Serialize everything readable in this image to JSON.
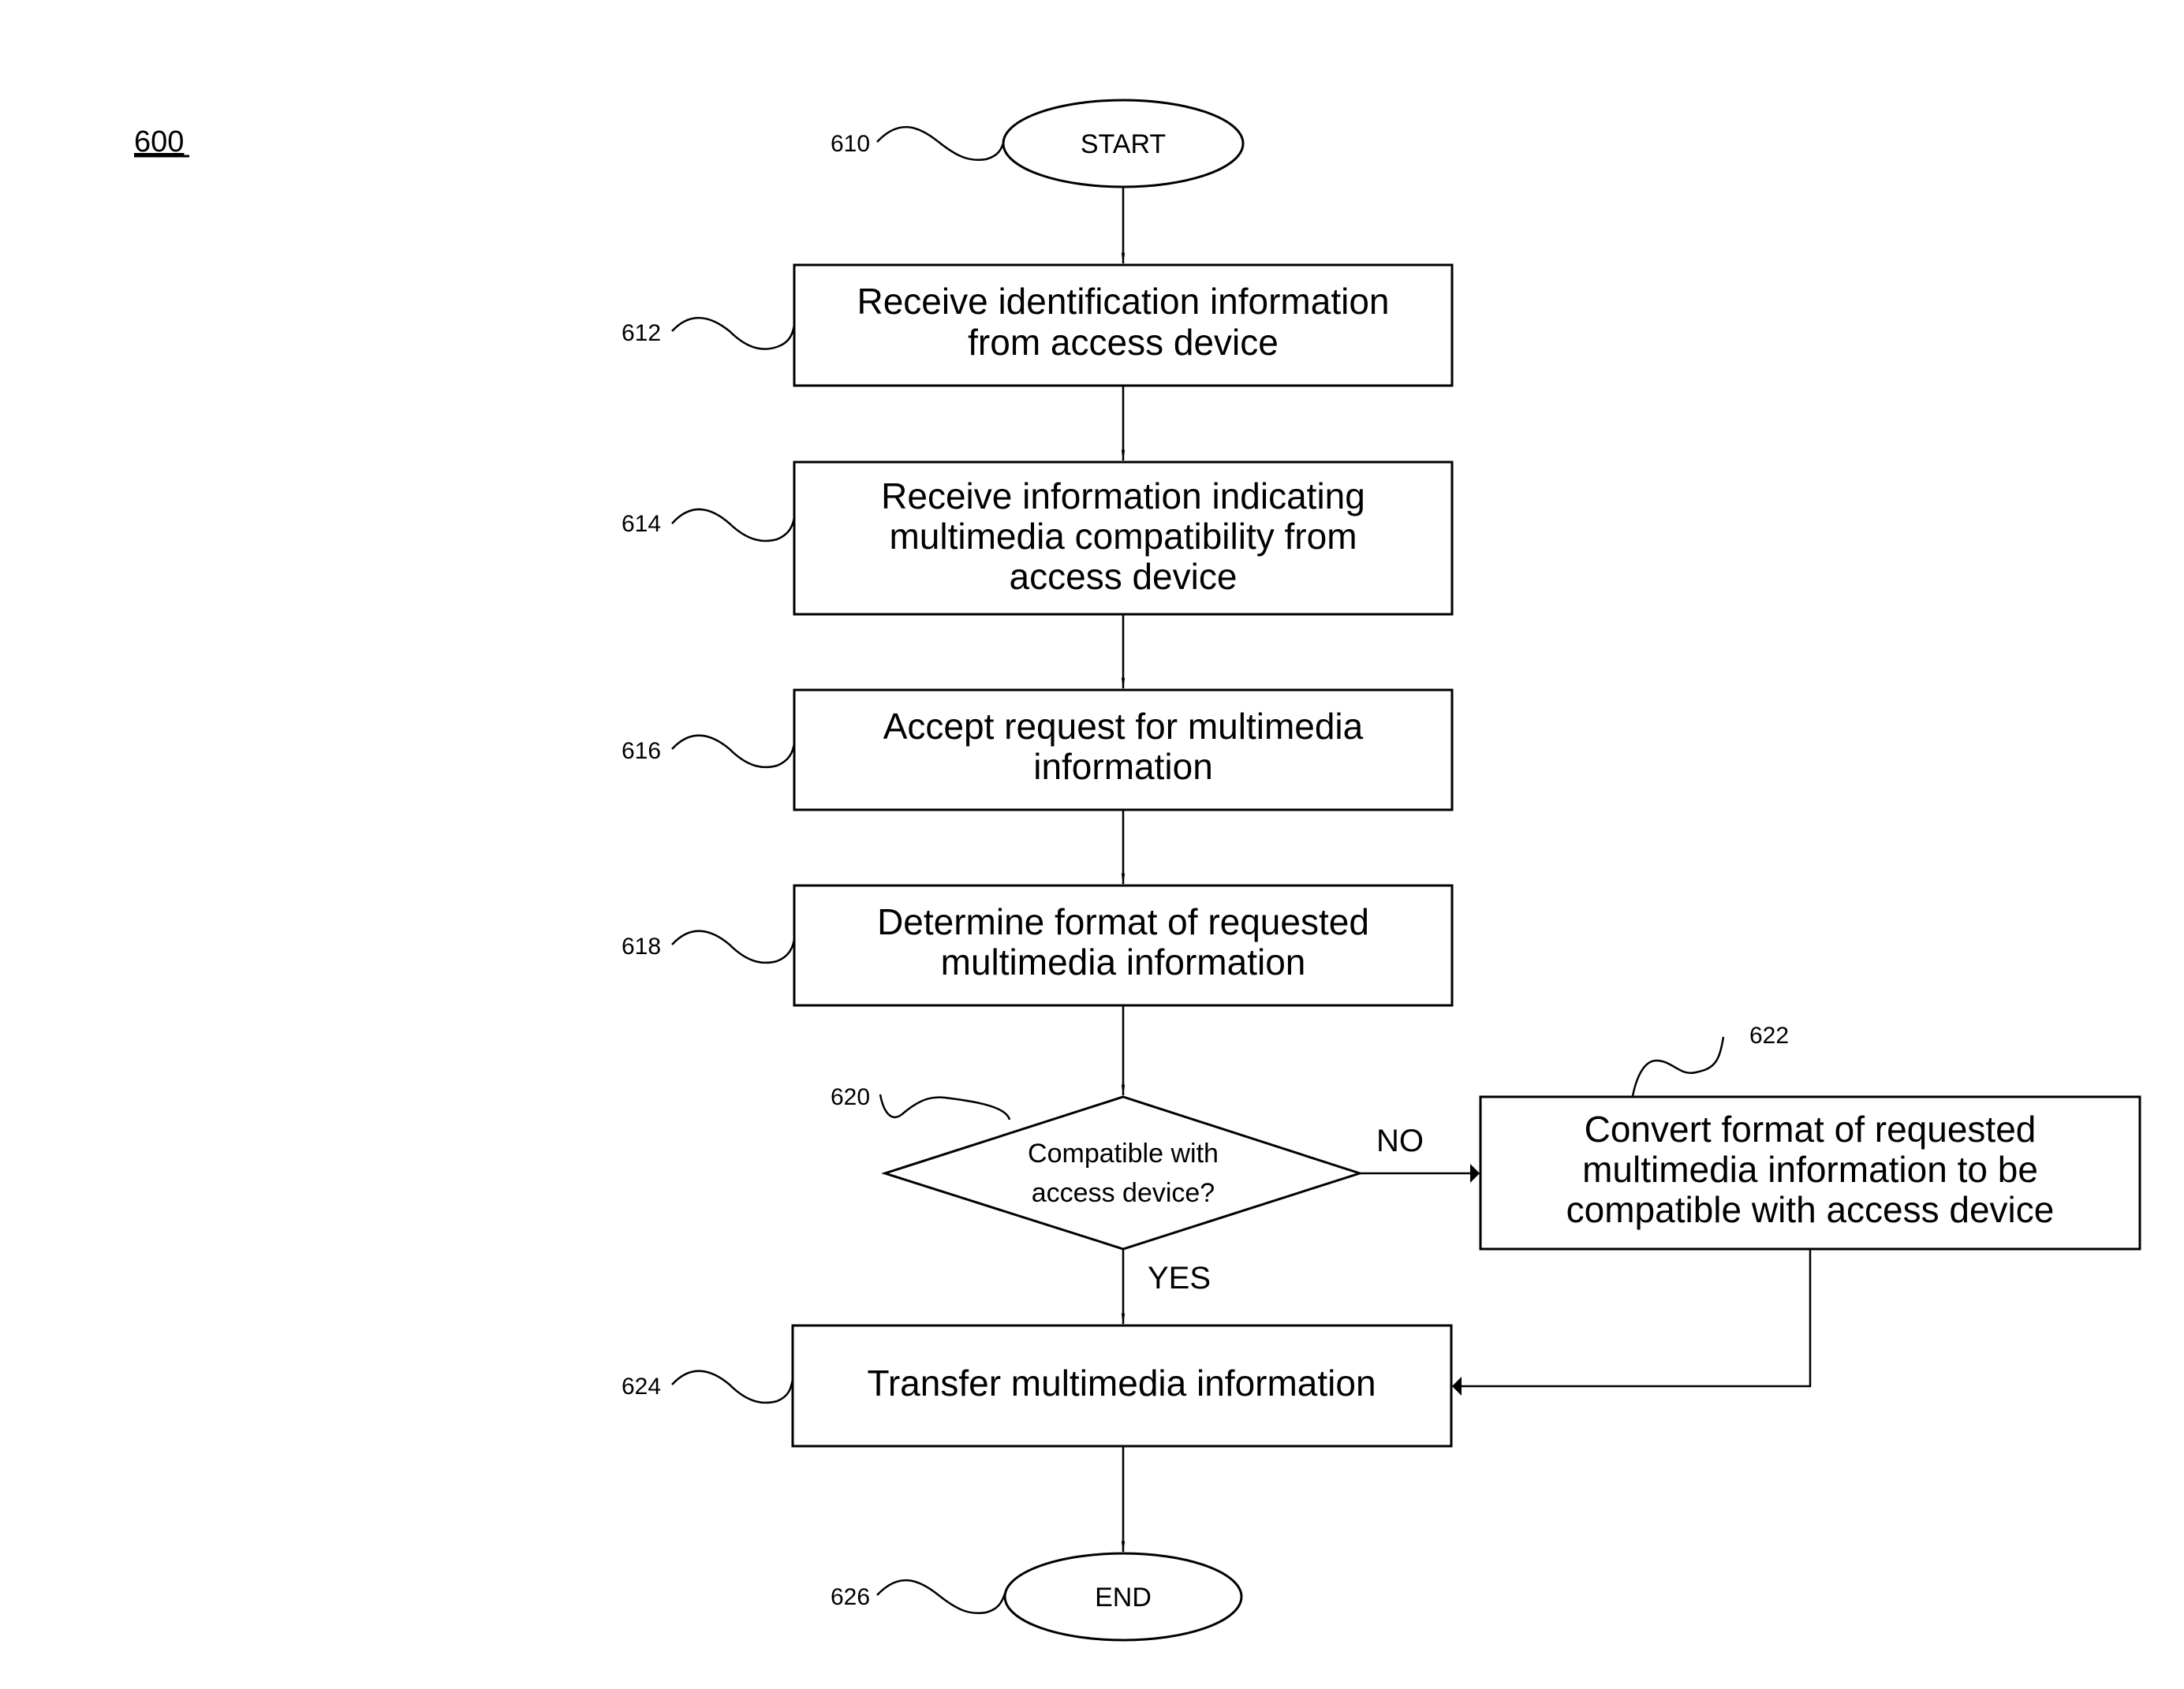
{
  "figure_number": "600",
  "nodes": {
    "start": {
      "ref": "610",
      "text": "START"
    },
    "n612": {
      "ref": "612",
      "lines": [
        "Receive identification information",
        "from access device"
      ]
    },
    "n614": {
      "ref": "614",
      "lines": [
        "Receive information indicating",
        "multimedia compatibility from",
        "access device"
      ]
    },
    "n616": {
      "ref": "616",
      "lines": [
        "Accept request for multimedia",
        "information"
      ]
    },
    "n618": {
      "ref": "618",
      "lines": [
        "Determine format of requested",
        "multimedia information"
      ]
    },
    "n620": {
      "ref": "620",
      "lines": [
        "Compatible with",
        "access device?"
      ]
    },
    "n622": {
      "ref": "622",
      "lines": [
        "Convert format of requested",
        "multimedia information to be",
        "compatible with access device"
      ]
    },
    "n624": {
      "ref": "624",
      "lines": [
        "Transfer multimedia information"
      ]
    },
    "end": {
      "ref": "626",
      "text": "END"
    }
  },
  "edges": {
    "no_label": "NO",
    "yes_label": "YES"
  }
}
